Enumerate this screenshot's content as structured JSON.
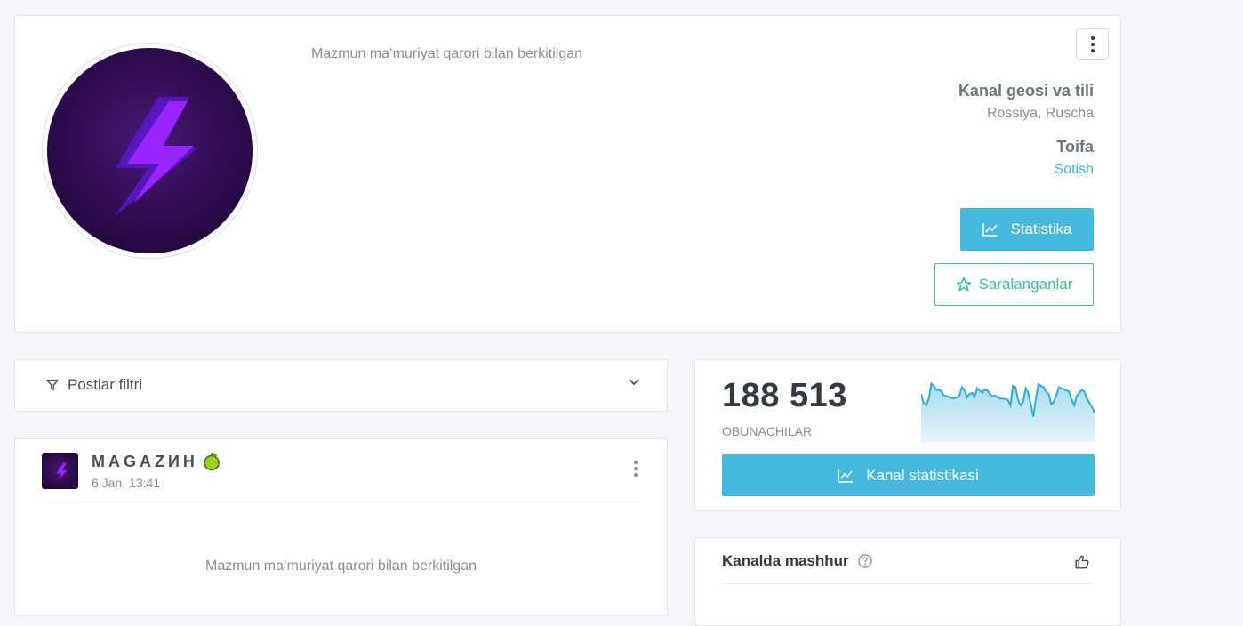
{
  "channel": {
    "blocked_text": "Mazmun ma’muriyat qarori bilan berkitilgan",
    "geo_label": "Kanal geosi va tili",
    "geo_value": "Rossiya, Ruscha",
    "category_label": "Toifa",
    "category_value": "Sotish",
    "stats_button": "Statistika",
    "favorites_button": "Saralanganlar",
    "avatar_icon": "lightning-bolt-icon"
  },
  "filter": {
    "label": "Postlar filtri"
  },
  "post": {
    "title": "MAGAZИН",
    "emoji": "green-apple-icon",
    "date": "6 Jan, 13:41",
    "blocked_text": "Mazmun ma’muriyat qarori bilan berkitilgan"
  },
  "subscribers": {
    "count": "188 513",
    "label": "OBUNACHILAR",
    "button": "Kanal statistikasi",
    "series": [
      78,
      62,
      58,
      70,
      96,
      92,
      85,
      86,
      82,
      75,
      74,
      72,
      71,
      70,
      72,
      75,
      90,
      85,
      72,
      78,
      80,
      73,
      88,
      84,
      80,
      86,
      84,
      78,
      74,
      75,
      72,
      70,
      70,
      69,
      68,
      58,
      92,
      90,
      68,
      58,
      64,
      88,
      80,
      60,
      38,
      70,
      95,
      92,
      90,
      82,
      78,
      60,
      64,
      75,
      90,
      88,
      86,
      84,
      82,
      68,
      58,
      74,
      80,
      85,
      82,
      70,
      62,
      55,
      45
    ]
  },
  "popular": {
    "title": "Kanalda mashhur"
  },
  "colors": {
    "primary": "#44b8dd",
    "success": "#33c497",
    "link": "#3bb9de"
  }
}
